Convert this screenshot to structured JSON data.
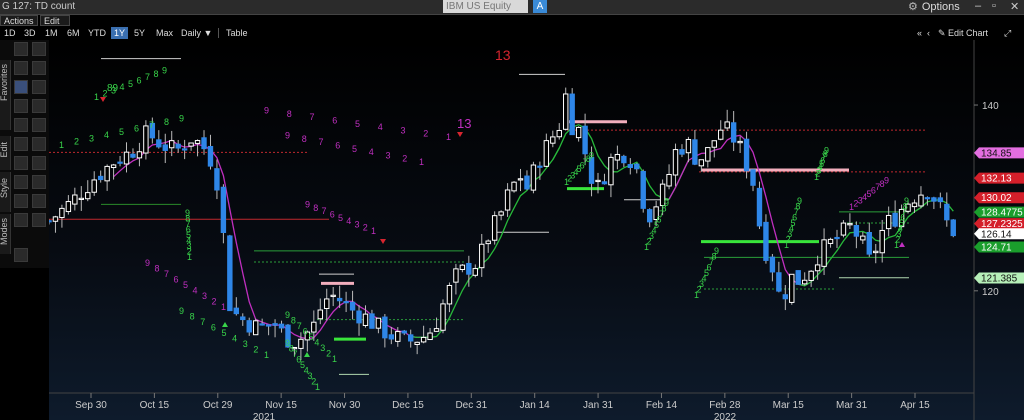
{
  "window": {
    "title": "G 127: TD count",
    "ticker": "IBM US Equity",
    "ticker_action": "A",
    "options_label": "Options",
    "controls": [
      "–",
      "▫",
      "✕"
    ]
  },
  "menu": {
    "actions": "Actions ▾",
    "edit": "Edit ▾"
  },
  "toolbar": {
    "ranges": [
      "1D",
      "3D",
      "1M",
      "6M",
      "YTD",
      "1Y",
      "5Y",
      "Max"
    ],
    "active_range": "1Y",
    "interval": "Daily ▼",
    "table": "Table",
    "edit_chart": "✎ Edit Chart",
    "nav": [
      "«",
      "‹"
    ]
  },
  "side_tabs": [
    "Favorites",
    "Edit",
    "Style",
    "Modes"
  ],
  "tool_icons": [
    "cursor-icon",
    "pencil-icon",
    "lock-icon",
    "ellipse-icon",
    "text-icon",
    "line-icon",
    "trend-line-icon",
    "channel-icon",
    "wave-icon",
    "r-icon",
    "pattern-icon",
    "grid-icon",
    "crosshair-icon",
    "trash-icon",
    "color-icon",
    "fill-icon",
    "eraser-icon",
    "link-icon",
    "zoom-icon",
    "palette-icon",
    "settings-icon"
  ],
  "chart_data": {
    "type": "candlestick",
    "title": "",
    "y_axis": {
      "min": 109,
      "max": 147,
      "ticks": [
        120,
        140
      ]
    },
    "x_ticks": [
      "Sep 30",
      "Oct 15",
      "Oct 29",
      "Nov 15",
      "Nov 30",
      "Dec 15",
      "Dec 31",
      "Jan 14",
      "Jan 31",
      "Feb 14",
      "Feb 28",
      "Mar 15",
      "Mar 31",
      "Apr 15"
    ],
    "x_years": [
      "2021",
      "2022"
    ],
    "price_badges": [
      {
        "value": "134.85",
        "bg": "#e36ee0",
        "fg": "#111"
      },
      {
        "value": "132.13",
        "bg": "#d41f2a",
        "fg": "#fff"
      },
      {
        "value": "130.02",
        "bg": "#d41f2a",
        "fg": "#fff"
      },
      {
        "value": "128.4775",
        "bg": "#1a9e2c",
        "fg": "#fff"
      },
      {
        "value": "127.2325",
        "bg": "#d41f2a",
        "fg": "#fff"
      },
      {
        "value": "126.14",
        "bg": "#ffffff",
        "fg": "#111"
      },
      {
        "value": "124.71",
        "bg": "#1a9e2c",
        "fg": "#fff"
      },
      {
        "value": "121.385",
        "bg": "#b7f0b9",
        "fg": "#111"
      }
    ],
    "annotations": [
      {
        "text": "13",
        "color": "#d7252f"
      },
      {
        "text": "13",
        "color": "#c02fc0"
      },
      {
        "text": "89",
        "color": "#38d44a"
      }
    ],
    "colors": {
      "up": "#ffffff",
      "down": "#2e86e8",
      "ma_green": "#27b83a",
      "ma_magenta": "#c02fc0"
    }
  }
}
